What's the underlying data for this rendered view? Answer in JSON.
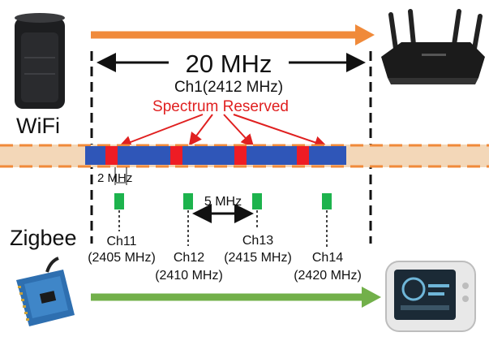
{
  "labels": {
    "wifi": "WiFi",
    "zigbee": "Zigbee",
    "bandwidth": "20 MHz",
    "wifi_channel": "Ch1(2412 MHz)",
    "reserved": "Spectrum Reserved",
    "zigbee_width": "2 MHz",
    "spacing": "5 MHz"
  },
  "zigbee_channels": [
    {
      "name": "Ch11",
      "freq": "(2405 MHz)"
    },
    {
      "name": "Ch12",
      "freq": "(2410 MHz)"
    },
    {
      "name": "Ch13",
      "freq": "(2415 MHz)"
    },
    {
      "name": "Ch14",
      "freq": "(2420 MHz)"
    }
  ],
  "colors": {
    "wifi_arrow": "#f08a3a",
    "zigbee_arrow": "#72b04a",
    "band": "#2f56b8",
    "reserved": "#ee1c24",
    "zigbee_channel": "#1db34d",
    "dash_band": "#f3d7b8",
    "dash_line": "#f08a3a"
  },
  "icons": [
    "smart-speaker-icon",
    "wifi-router-icon",
    "zigbee-module-icon",
    "smart-display-icon"
  ]
}
